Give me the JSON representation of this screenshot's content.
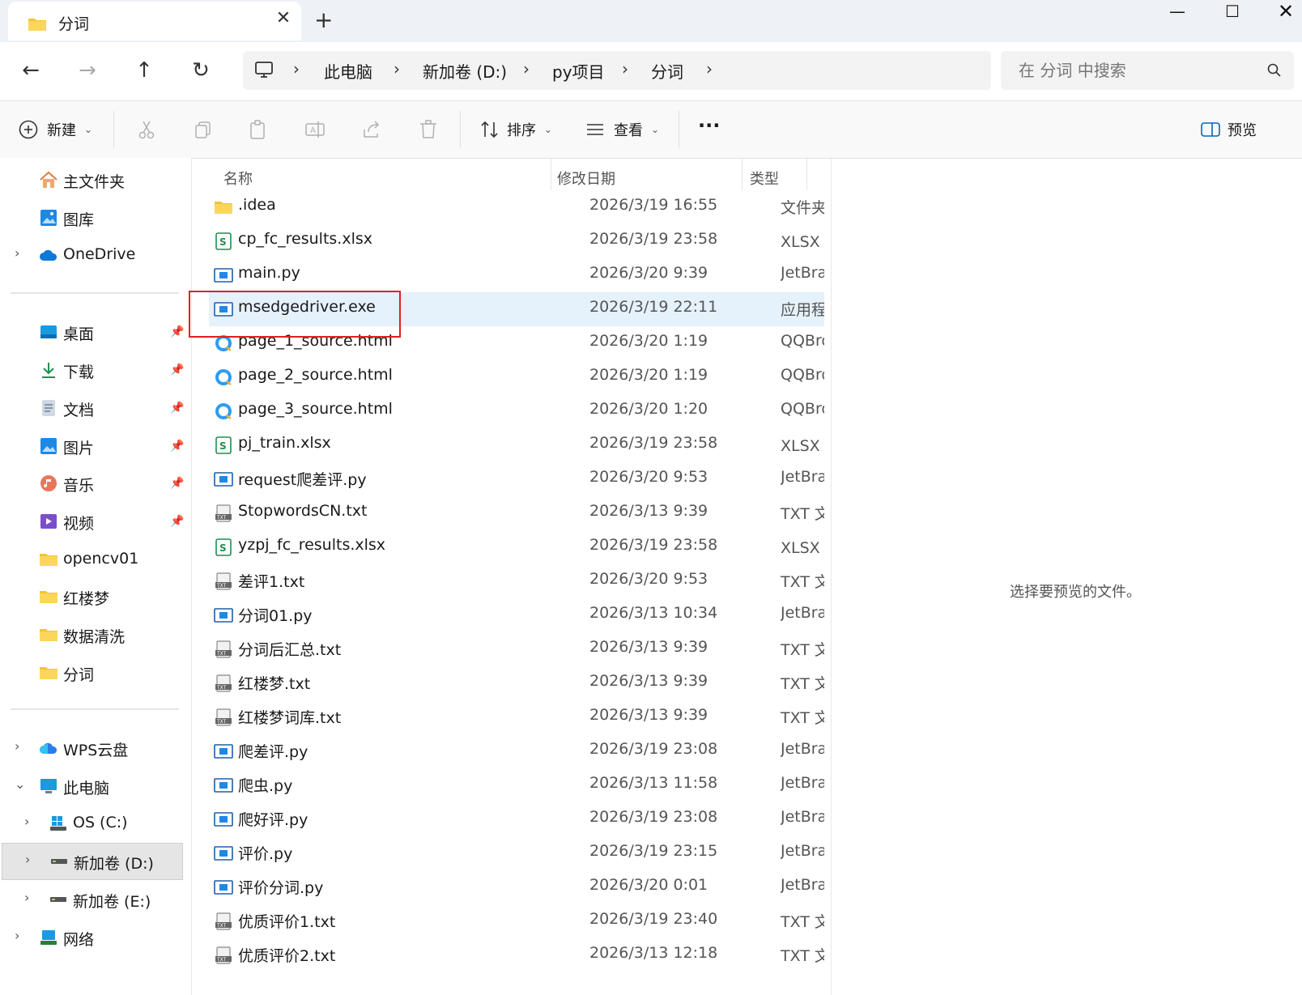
{
  "window": {
    "tab_title": "分词",
    "new_tab": "+",
    "min": "—",
    "max": "☐",
    "close": "✕"
  },
  "nav": {
    "back": "←",
    "forward": "→",
    "up": "↑",
    "refresh": "↻",
    "breadcrumbs": [
      "此电脑",
      "新加卷 (D:)",
      "py项目",
      "分词"
    ],
    "search_placeholder": "在 分词 中搜索"
  },
  "toolbar": {
    "new_label": "新建",
    "sort_label": "排序",
    "view_label": "查看",
    "more": "···",
    "preview_label": "预览"
  },
  "sidebar": {
    "quick": [
      {
        "label": "主文件夹",
        "icon": "home-icon"
      },
      {
        "label": "图库",
        "icon": "gallery-icon"
      },
      {
        "label": "OneDrive",
        "icon": "cloud-icon"
      }
    ],
    "pinned": [
      {
        "label": "桌面",
        "icon": "desktop-icon"
      },
      {
        "label": "下载",
        "icon": "download-icon"
      },
      {
        "label": "文档",
        "icon": "document-icon"
      },
      {
        "label": "图片",
        "icon": "pictures-icon"
      },
      {
        "label": "音乐",
        "icon": "music-icon"
      },
      {
        "label": "视频",
        "icon": "video-icon"
      }
    ],
    "folders": [
      {
        "label": "opencv01"
      },
      {
        "label": "红楼梦"
      },
      {
        "label": "数据清洗"
      },
      {
        "label": "分词"
      }
    ],
    "locations": [
      {
        "label": "WPS云盘",
        "icon": "wps-cloud-icon"
      },
      {
        "label": "此电脑",
        "icon": "this-pc-icon"
      },
      {
        "label": "OS (C:)",
        "icon": "os-drive-icon"
      },
      {
        "label": "新加卷 (D:)",
        "icon": "drive-icon"
      },
      {
        "label": "新加卷 (E:)",
        "icon": "drive-icon"
      },
      {
        "label": "网络",
        "icon": "network-icon"
      }
    ]
  },
  "columns": {
    "name": "名称",
    "date": "修改日期",
    "type": "类型"
  },
  "files": [
    {
      "name": ".idea",
      "date": "2026/3/19 16:55",
      "type": "文件夹",
      "icon": "folder-icon"
    },
    {
      "name": "cp_fc_results.xlsx",
      "date": "2026/3/19 23:58",
      "type": "XLSX 工作表",
      "icon": "xlsx-icon"
    },
    {
      "name": "main.py",
      "date": "2026/3/20 9:39",
      "type": "JetBrains",
      "icon": "py-icon"
    },
    {
      "name": "msedgedriver.exe",
      "date": "2026/3/19 22:11",
      "type": "应用程序",
      "icon": "exe-icon"
    },
    {
      "name": "page_1_source.html",
      "date": "2026/3/20 1:19",
      "type": "QQBrowser",
      "icon": "browser-icon"
    },
    {
      "name": "page_2_source.html",
      "date": "2026/3/20 1:19",
      "type": "QQBrowser",
      "icon": "browser-icon"
    },
    {
      "name": "page_3_source.html",
      "date": "2026/3/20 1:20",
      "type": "QQBrowser",
      "icon": "browser-icon"
    },
    {
      "name": "pj_train.xlsx",
      "date": "2026/3/19 23:58",
      "type": "XLSX 工作表",
      "icon": "xlsx-icon"
    },
    {
      "name": "request爬差评.py",
      "date": "2026/3/20 9:53",
      "type": "JetBrains",
      "icon": "py-icon"
    },
    {
      "name": "StopwordsCN.txt",
      "date": "2026/3/13 9:39",
      "type": "TXT 文本",
      "icon": "txt-icon"
    },
    {
      "name": "yzpj_fc_results.xlsx",
      "date": "2026/3/19 23:58",
      "type": "XLSX 工作表",
      "icon": "xlsx-icon"
    },
    {
      "name": "差评1.txt",
      "date": "2026/3/20 9:53",
      "type": "TXT 文本",
      "icon": "txt-icon"
    },
    {
      "name": "分词01.py",
      "date": "2026/3/13 10:34",
      "type": "JetBrains",
      "icon": "py-icon"
    },
    {
      "name": "分词后汇总.txt",
      "date": "2026/3/13 9:39",
      "type": "TXT 文本",
      "icon": "txt-icon"
    },
    {
      "name": "红楼梦.txt",
      "date": "2026/3/13 9:39",
      "type": "TXT 文本",
      "icon": "txt-icon"
    },
    {
      "name": "红楼梦词库.txt",
      "date": "2026/3/13 9:39",
      "type": "TXT 文本",
      "icon": "txt-icon"
    },
    {
      "name": "爬差评.py",
      "date": "2026/3/19 23:08",
      "type": "JetBrains",
      "icon": "py-icon"
    },
    {
      "name": "爬虫.py",
      "date": "2026/3/13 11:58",
      "type": "JetBrains",
      "icon": "py-icon"
    },
    {
      "name": "爬好评.py",
      "date": "2026/3/19 23:08",
      "type": "JetBrains",
      "icon": "py-icon"
    },
    {
      "name": "评价.py",
      "date": "2026/3/19 23:15",
      "type": "JetBrains",
      "icon": "py-icon"
    },
    {
      "name": "评价分词.py",
      "date": "2026/3/20 0:01",
      "type": "JetBrains",
      "icon": "py-icon"
    },
    {
      "name": "优质评价1.txt",
      "date": "2026/3/19 23:40",
      "type": "TXT 文本",
      "icon": "txt-icon"
    },
    {
      "name": "优质评价2.txt",
      "date": "2026/3/13 12:18",
      "type": "TXT 文本",
      "icon": "txt-icon"
    }
  ],
  "selected_index": 3,
  "preview": {
    "message": "选择要预览的文件。"
  },
  "colors": {
    "accent": "#0067c0",
    "selection": "#e5f1fb",
    "highlight_box": "#e02020",
    "folder": "#f4c430"
  }
}
